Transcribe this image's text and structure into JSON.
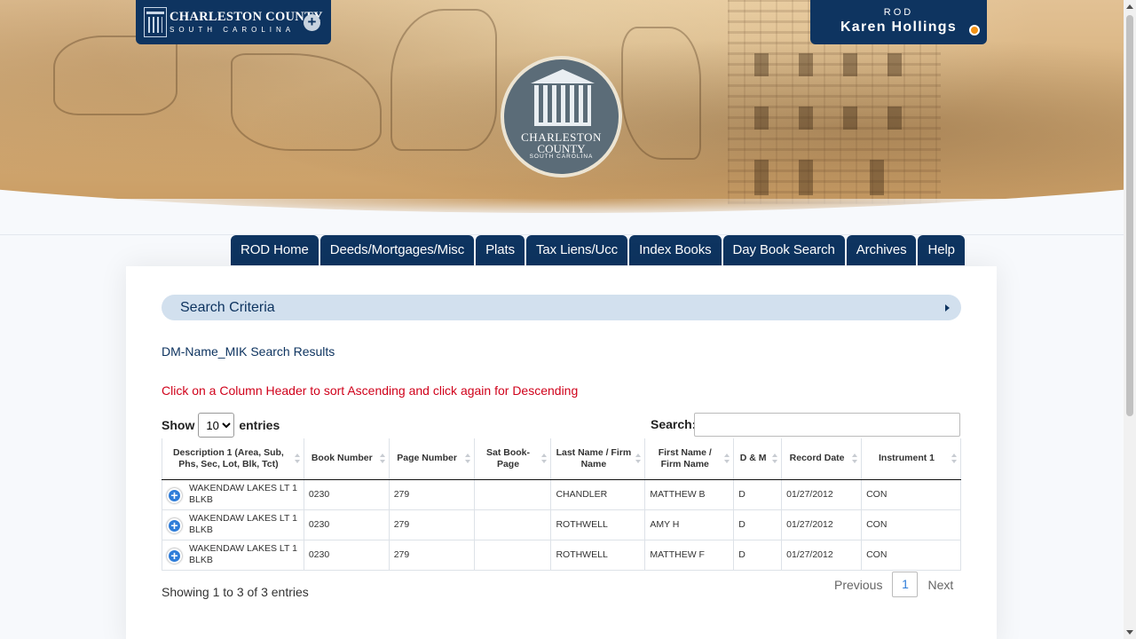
{
  "brand": {
    "name": "CHARLESTON COUNTY",
    "sub": "SOUTH CAROLINA",
    "plus": "+"
  },
  "user": {
    "role": "ROD",
    "name": "Karen Hollings"
  },
  "seal": {
    "line1": "CHARLESTON",
    "line2": "COUNTY",
    "line3": "SOUTH CAROLINA"
  },
  "nav": [
    "ROD Home",
    "Deeds/Mortgages/Misc",
    "Plats",
    "Tax Liens/Ucc",
    "Index Books",
    "Day Book Search",
    "Archives",
    "Help"
  ],
  "criteria": {
    "label": "Search Criteria"
  },
  "results_title": "DM-Name_MIK Search Results",
  "sort_hint": "Click on a Column Header to sort Ascending and click again for Descending",
  "length": {
    "show": "Show",
    "value": "10",
    "entries": "entries",
    "options": [
      "10"
    ]
  },
  "search": {
    "label": "Search:",
    "value": ""
  },
  "table": {
    "headers": [
      "Description 1 (Area, Sub, Phs, Sec, Lot, Blk, Tct)",
      "Book Number",
      "Page Number",
      "Sat Book-Page",
      "Last Name / Firm Name",
      "First Name / Firm Name",
      "D & M",
      "Record Date",
      "Instrument 1"
    ],
    "rows": [
      [
        "WAKENDAW LAKES LT 1 BLKB",
        "0230",
        "279",
        "",
        "CHANDLER",
        "MATTHEW B",
        "D",
        "01/27/2012",
        "CON"
      ],
      [
        "WAKENDAW LAKES LT 1 BLKB",
        "0230",
        "279",
        "",
        "ROTHWELL",
        "AMY H",
        "D",
        "01/27/2012",
        "CON"
      ],
      [
        "WAKENDAW LAKES LT 1 BLKB",
        "0230",
        "279",
        "",
        "ROTHWELL",
        "MATTHEW F",
        "D",
        "01/27/2012",
        "CON"
      ]
    ]
  },
  "info": "Showing 1 to 3 of 3 entries",
  "pager": {
    "previous": "Previous",
    "current": "1",
    "next": "Next"
  }
}
